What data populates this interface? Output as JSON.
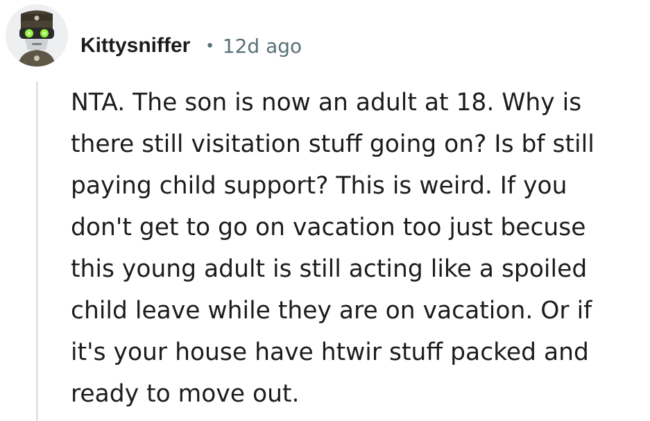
{
  "comment": {
    "author": "Kittysniffer",
    "separator": "•",
    "timestamp": "12d ago",
    "avatar_icon": "robot-avatar-icon",
    "body": "NTA. The son is now an adult at 18. Why is\nthere still visitation stuff going on? Is bf still\npaying child support? This is weird. If you\ndon't get to go on vacation too just becuse\nthis young adult is still acting like a spoiled\nchild leave while they are on vacation. Or if\nit's your house have htwir stuff packed and\nready to move out."
  },
  "colors": {
    "text": "#1c1c1c",
    "meta": "#576f76",
    "thread_line": "#e2e4e6",
    "avatar_bg": "#edeff1",
    "avatar_eyes": "#8ef23a"
  }
}
